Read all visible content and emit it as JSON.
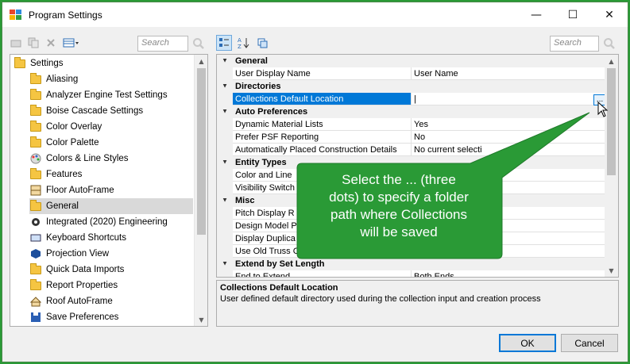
{
  "window": {
    "title": "Program Settings",
    "minimize": "—",
    "maximize": "☐",
    "close": "✕"
  },
  "search": {
    "left_placeholder": "Search",
    "right_placeholder": "Search"
  },
  "tree": {
    "root_label": "Settings",
    "items": [
      {
        "label": "Aliasing",
        "icon": "folder-icon"
      },
      {
        "label": "Analyzer Engine Test Settings",
        "icon": "folder-icon"
      },
      {
        "label": "Boise Cascade Settings",
        "icon": "folder-icon"
      },
      {
        "label": "Color Overlay",
        "icon": "folder-icon"
      },
      {
        "label": "Color Palette",
        "icon": "folder-icon"
      },
      {
        "label": "Colors & Line Styles",
        "icon": "palette-icon"
      },
      {
        "label": "Features",
        "icon": "folder-icon"
      },
      {
        "label": "Floor AutoFrame",
        "icon": "floor-frame-icon"
      },
      {
        "label": "General",
        "icon": "folder-icon"
      },
      {
        "label": "Integrated (2020) Engineering",
        "icon": "gear-icon"
      },
      {
        "label": "Keyboard Shortcuts",
        "icon": "keyboard-icon"
      },
      {
        "label": "Projection View",
        "icon": "projection-icon"
      },
      {
        "label": "Quick Data Imports",
        "icon": "folder-icon"
      },
      {
        "label": "Report Properties",
        "icon": "folder-icon"
      },
      {
        "label": "Roof AutoFrame",
        "icon": "roof-frame-icon"
      },
      {
        "label": "Save Preferences",
        "icon": "save-icon"
      }
    ],
    "selected": "General"
  },
  "grid": {
    "rows": [
      {
        "type": "cat",
        "label": "General"
      },
      {
        "type": "prop",
        "name": "User Display Name",
        "value": "User Name"
      },
      {
        "type": "cat",
        "label": "Directories"
      },
      {
        "type": "prop",
        "name": "Collections Default Location",
        "value": "|",
        "selected": true
      },
      {
        "type": "cat",
        "label": "Auto Preferences"
      },
      {
        "type": "prop",
        "name": "Dynamic Material Lists",
        "value": "Yes"
      },
      {
        "type": "prop",
        "name": "Prefer PSF Reporting",
        "value": "No"
      },
      {
        "type": "prop",
        "name": "Automatically Placed Construction Details",
        "value": "No current selecti"
      },
      {
        "type": "cat",
        "label": "Entity Types"
      },
      {
        "type": "prop",
        "name": "Color and Line",
        "value": ""
      },
      {
        "type": "prop",
        "name": "Visibility Switch",
        "value": ""
      },
      {
        "type": "cat",
        "label": "Misc"
      },
      {
        "type": "prop",
        "name": "Pitch Display R",
        "value": ""
      },
      {
        "type": "prop",
        "name": "Design Model P",
        "value": ""
      },
      {
        "type": "prop",
        "name": "Display Duplica",
        "value": ""
      },
      {
        "type": "prop",
        "name": "Use Old Truss C",
        "value": ""
      },
      {
        "type": "cat",
        "label": "Extend by Set Length"
      },
      {
        "type": "prop",
        "name": "End to Extend",
        "value": "Both Ends"
      }
    ],
    "ellipsis": "..."
  },
  "description": {
    "title": "Collections Default Location",
    "text": "User defined default directory used during the collection input and creation process"
  },
  "buttons": {
    "ok": "OK",
    "cancel": "Cancel"
  },
  "callout": {
    "lines": [
      "Select the ... (three",
      "dots) to specify a folder",
      "path where Collections",
      "will be saved"
    ],
    "color": "#2a9a36"
  },
  "colors": {
    "selection": "#0078d7",
    "callout": "#2a9a36",
    "folder": "#f5c542"
  }
}
